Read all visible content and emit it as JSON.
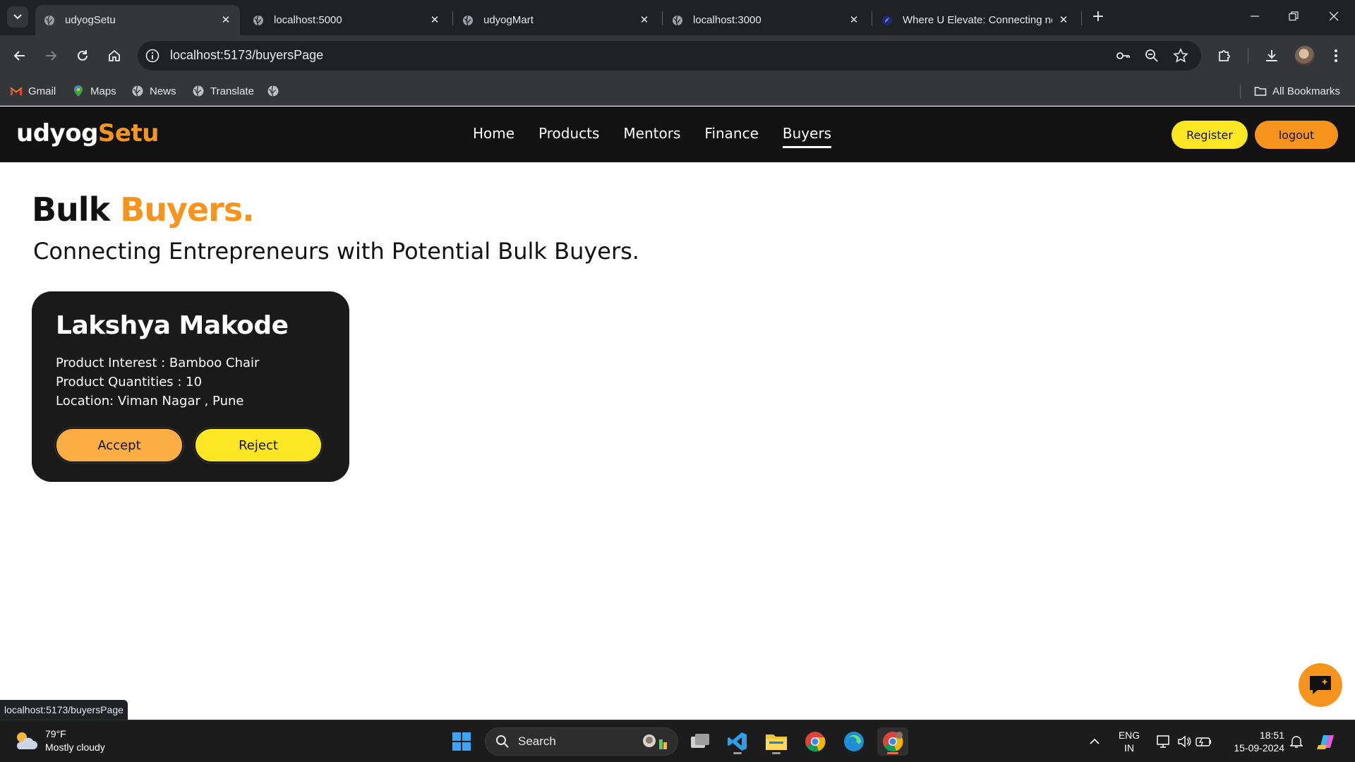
{
  "browser": {
    "tabs": [
      {
        "title": "udyogSetu",
        "active": true
      },
      {
        "title": "localhost:5000",
        "active": false
      },
      {
        "title": "udyogMart",
        "active": false
      },
      {
        "title": "localhost:3000",
        "active": false
      },
      {
        "title": "Where U Elevate: Connecting ne",
        "active": false
      }
    ],
    "url": "localhost:5173/buyersPage",
    "bookmarks": [
      "Gmail",
      "Maps",
      "News",
      "Translate"
    ],
    "all_bookmarks_label": "All Bookmarks",
    "status_url": "localhost:5173/buyersPage"
  },
  "site": {
    "logo_white": "udyog",
    "logo_orange": "Setu",
    "nav": [
      "Home",
      "Products",
      "Mentors",
      "Finance",
      "Buyers"
    ],
    "active_nav": "Buyers",
    "register_label": "Register",
    "logout_label": "logout",
    "colors": {
      "orange": "#f7941d",
      "yellow": "#fde725",
      "accept": "#fcae45",
      "dark": "#121212"
    }
  },
  "page": {
    "title_black": "Bulk",
    "title_orange": "Buyers.",
    "subtitle": "Connecting Entrepreneurs with Potential Bulk Buyers.",
    "buyers": [
      {
        "name": "Lakshya Makode",
        "interest": "Product Interest : Bamboo Chair",
        "quantities": "Product Quantities : 10",
        "location": "Location: Viman Nagar , Pune",
        "accept_label": "Accept",
        "reject_label": "Reject"
      }
    ]
  },
  "taskbar": {
    "temp": "79°F",
    "weather": "Mostly cloudy",
    "search_label": "Search",
    "lang_top": "ENG",
    "lang_bottom": "IN",
    "time": "18:51",
    "date": "15-09-2024"
  }
}
